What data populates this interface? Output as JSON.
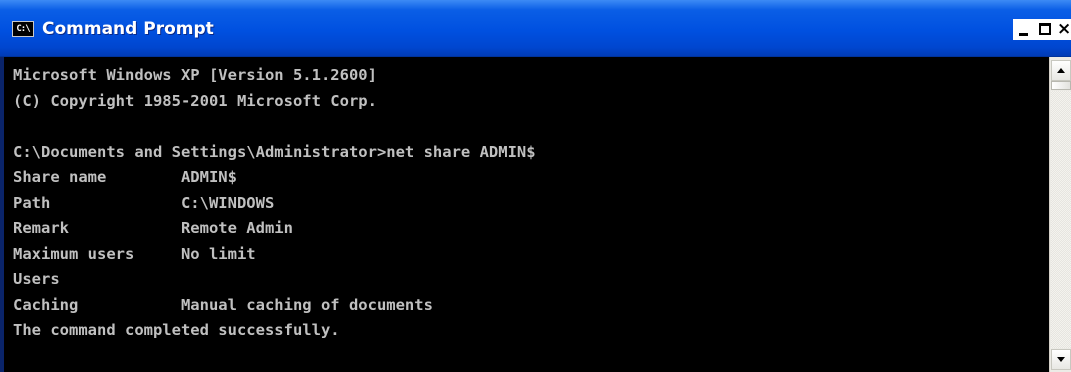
{
  "window": {
    "title": "Command Prompt",
    "icon": "cmd-icon",
    "icon_text": "C:\\",
    "buttons": {
      "minimize": "minimize-icon",
      "maximize": "maximize-icon",
      "close": "close-icon",
      "close_glyph": "×"
    },
    "colors": {
      "titlebar": "#0050e0",
      "console_background": "#000000",
      "console_text": "#c0c0c0"
    }
  },
  "console": {
    "lines": [
      "Microsoft Windows XP [Version 5.1.2600]",
      "(C) Copyright 1985-2001 Microsoft Corp.",
      "",
      "C:\\Documents and Settings\\Administrator>net share ADMIN$",
      "Share name        ADMIN$",
      "Path              C:\\WINDOWS",
      "Remark            Remote Admin",
      "Maximum users     No limit",
      "Users",
      "Caching           Manual caching of documents",
      "The command completed successfully."
    ]
  },
  "scrollbar": {
    "up_icon": "scroll-up-arrow-icon",
    "down_icon": "scroll-down-arrow-icon"
  }
}
